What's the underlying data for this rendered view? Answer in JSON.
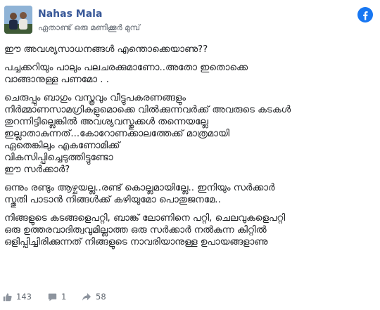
{
  "post": {
    "author": "Nahas Mala",
    "timestamp": "ഏതാണ്ട് ഒരു മണിക്കൂർ മുമ്പ്",
    "paragraphs": [
      {
        "lines": [
          "ഈ അവശ്യസാധനങ്ങൾ എന്തൊക്കെയാണു??"
        ]
      },
      {
        "lines": [
          "പച്ചക്കറിയും പാലും പലചരക്കുമാണോ..അതോ ഇതൊക്കെ",
          "വാങ്ങാനുള്ള പണമോ . ."
        ]
      },
      {
        "lines": [
          "ചെരുപ്പും ബാഗും വസ്ത്രവും വീട്ടുപകരണങ്ങളും",
          "നിർമ്മാണസാമഗ്രികളുമൊക്കെ വിൽക്കുന്നവർക്ക് അവരുടെ കടകൾ",
          "തുറന്നിട്ടില്ലെങ്കിൽ അവശ്യവസ്തുക്കൾ തന്നെയല്ലേ",
          "ഇല്ലാതാകുന്നത്...കോറോണക്കാലത്തേക്ക് മാത്രമായി",
          "ഏതെങ്കിലും എകണോമിക്ക്",
          "വികസിപ്പിച്ചെടുത്തിട്ടുണ്ടോ",
          "ഈ സർക്കാർ?"
        ]
      },
      {
        "lines": [
          "ഒന്നും രണ്ടും ആഴ്ചയല്ല..രണ്ട് കൊല്ലമായില്ലേ.. ഇനിയും സർക്കാർ",
          "സ്തുതി പാടാൻ നിങ്ങൾക്ക് കഴിയുമോ പൊതുജനമേ.."
        ]
      },
      {
        "lines": [
          "നിങ്ങളുടെ കടങ്ങളെപറ്റി, ബാങ്ക് ലോണിനെ പറ്റി, ചെലവുകളെപറ്റി",
          "ഒരു ഉത്തരവാദിത്വവുമില്ലാത്ത ഒരു സർക്കാർ നൽകുന്ന കിറ്റിൽ",
          "ഒളിപ്പിച്ചിരിക്കുന്നത് നിങ്ങളുടെ നാവരിയാനുള്ള ഉപായങ്ങളാണു"
        ]
      }
    ]
  },
  "footer": {
    "likes": "143",
    "comments": "1",
    "shares": "58"
  },
  "colors": {
    "author": "#385898",
    "facebook_brand": "#1877f2",
    "muted_text": "#606770",
    "body_text": "#1c1e21"
  },
  "icons": {
    "brand": "facebook-logo-icon",
    "like": "thumbs-up-icon",
    "comment": "comment-icon",
    "share": "share-icon"
  }
}
